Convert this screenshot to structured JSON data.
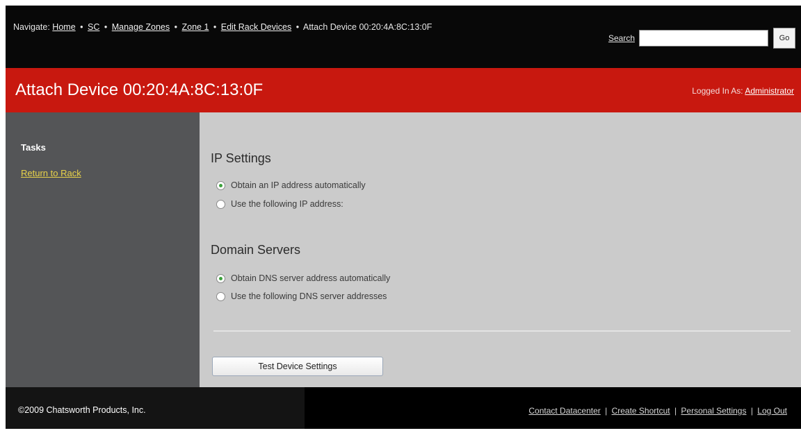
{
  "nav": {
    "prefix": "Navigate:",
    "separator": "•",
    "links": [
      "Home",
      "SC",
      "Manage Zones",
      "Zone 1",
      "Edit Rack Devices"
    ],
    "current": "Attach Device 00:20:4A:8C:13:0F"
  },
  "search": {
    "label": "Search",
    "value": "",
    "go_label": "Go"
  },
  "header": {
    "title": "Attach Device 00:20:4A:8C:13:0F",
    "logged_in_label": "Logged In As:",
    "user": "Administrator",
    "accent_color": "#c8180f"
  },
  "sidebar": {
    "heading": "Tasks",
    "items": [
      {
        "label": "Return to Rack"
      }
    ]
  },
  "ip_settings": {
    "title": "IP Settings",
    "options": [
      {
        "label": "Obtain an IP address automatically",
        "selected": true
      },
      {
        "label": "Use the following IP address:",
        "selected": false
      }
    ]
  },
  "domain_servers": {
    "title": "Domain Servers",
    "options": [
      {
        "label": "Obtain DNS server address automatically",
        "selected": true
      },
      {
        "label": "Use the following DNS server addresses",
        "selected": false
      }
    ]
  },
  "actions": {
    "test_label": "Test Device Settings"
  },
  "footer": {
    "copyright": "©2009 Chatsworth Products, Inc.",
    "links": [
      "Contact Datacenter",
      "Create Shortcut",
      "Personal Settings",
      "Log Out"
    ],
    "divider": "|"
  }
}
